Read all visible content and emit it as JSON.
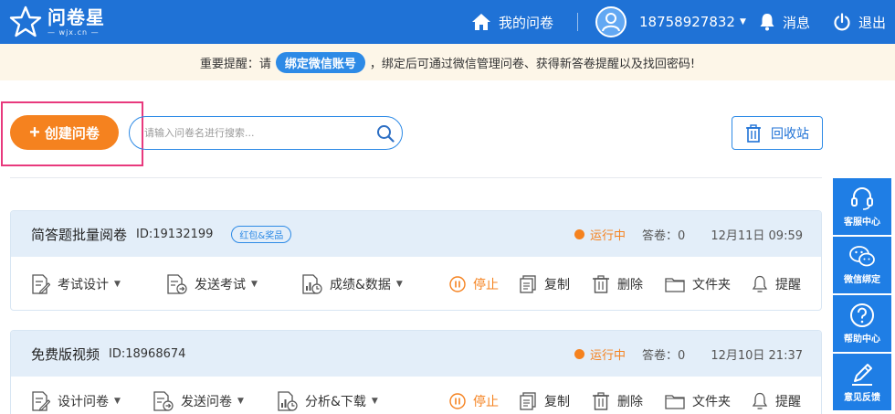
{
  "header": {
    "logo_name": "问卷星",
    "logo_sub": "— wjx.cn —",
    "my_surveys": "我的问卷",
    "user_phone": "18758927832",
    "messages": "消息",
    "logout": "退出"
  },
  "notice": {
    "prefix": "重要提醒：请",
    "pill": "绑定微信账号",
    "suffix": "，绑定后可通过微信管理问卷、获得新答卷提醒以及找回密码!"
  },
  "toolbar": {
    "create_label": "创建问卷",
    "search_placeholder": "请输入问卷名进行搜索...",
    "recycle_label": "回收站"
  },
  "surveys": [
    {
      "title": "简答题批量阅卷",
      "id": "ID:19132199",
      "tag": "红包&奖品",
      "status": "运行中",
      "answers": "答卷：0",
      "date": "12月11日 09:59",
      "actions": {
        "design": "考试设计",
        "send": "发送考试",
        "data": "成绩&数据",
        "stop": "停止",
        "copy": "复制",
        "delete": "删除",
        "folder": "文件夹",
        "remind": "提醒"
      }
    },
    {
      "title": "免费版视频",
      "id": "ID:18968674",
      "status": "运行中",
      "answers": "答卷：0",
      "date": "12月10日 21:37",
      "actions": {
        "design": "设计问卷",
        "send": "发送问卷",
        "data": "分析&下载",
        "stop": "停止",
        "copy": "复制",
        "delete": "删除",
        "folder": "文件夹",
        "remind": "提醒"
      }
    }
  ],
  "float_menu": {
    "service": "客服中心",
    "wechat": "微信绑定",
    "help": "帮助中心",
    "feedback": "意见反馈"
  },
  "colors": {
    "header": "#1f72d6",
    "accent_orange": "#f5821f",
    "highlight": "#e8397d",
    "float": "#1f7ee5"
  }
}
